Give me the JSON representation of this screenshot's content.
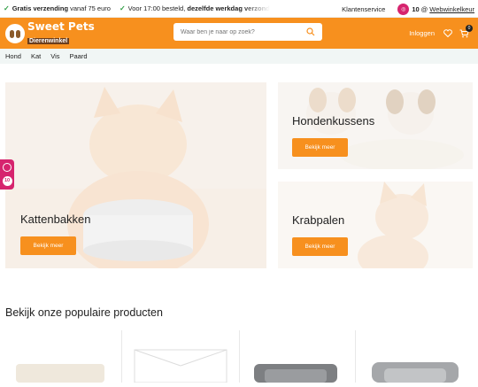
{
  "topbar": {
    "usp1_bold": "Gratis verzending",
    "usp1_rest": "vanaf 75 euro",
    "usp2_pre": "Voor 17:00 besteld,",
    "usp2_bold": "dezelfde werkdag verzonden",
    "customer_service": "Klantenservice",
    "review_score": "10",
    "review_at": "@",
    "review_link": "Webwinkelkeur"
  },
  "header": {
    "brand": "Sweet Pets",
    "brand_sub": "Dierenwinkel",
    "search_placeholder": "Waar ben je naar op zoek?",
    "login": "Inloggen",
    "cart_count": "0"
  },
  "categories": [
    "Hond",
    "Kat",
    "Vis",
    "Paard"
  ],
  "tiles": {
    "cat_bowls": {
      "title": "Kattenbakken",
      "button": "Bekijk meer"
    },
    "dog_cushions": {
      "title": "Hondenkussens",
      "button": "Bekijk meer"
    },
    "scratch_posts": {
      "title": "Krabpalen",
      "button": "Bekijk meer"
    }
  },
  "side_badge": {
    "score": "10"
  },
  "popular_title": "Bekijk onze populaire producten",
  "colors": {
    "accent": "#f7901e",
    "review_pink": "#d6246e",
    "check_green": "#2e9e44",
    "nav_bg": "#f1f6f5"
  }
}
